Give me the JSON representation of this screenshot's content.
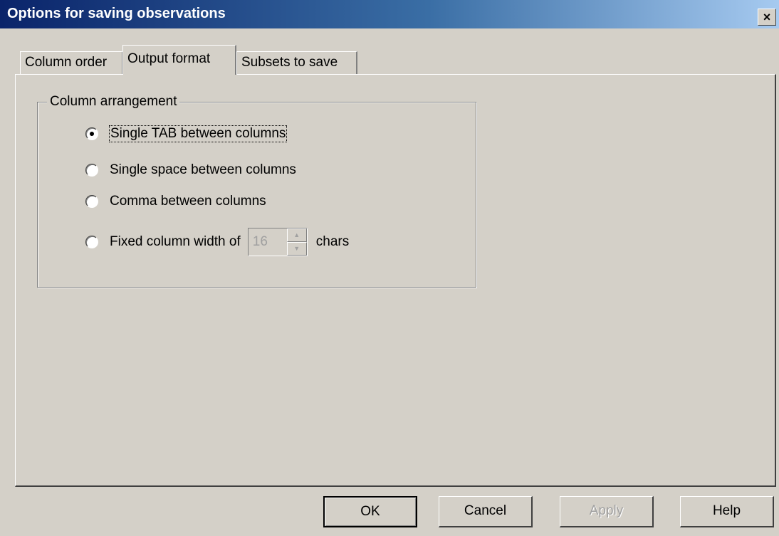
{
  "window": {
    "title": "Options for saving observations",
    "close_symbol": "×"
  },
  "tabs": [
    {
      "label": "Column order",
      "active": false
    },
    {
      "label": "Output format",
      "active": true
    },
    {
      "label": "Subsets to save",
      "active": false
    }
  ],
  "column_arrangement": {
    "label": "Column arrangement",
    "options": [
      {
        "label": "Single TAB between columns",
        "checked": true
      },
      {
        "label": "Single space between columns",
        "checked": false
      },
      {
        "label": "Comma between columns",
        "checked": false
      },
      {
        "label": "Fixed column width of",
        "checked": false
      }
    ],
    "width_value": "16",
    "width_unit": "chars"
  },
  "buttons": {
    "ok": "OK",
    "cancel": "Cancel",
    "apply": "Apply",
    "help": "Help"
  }
}
